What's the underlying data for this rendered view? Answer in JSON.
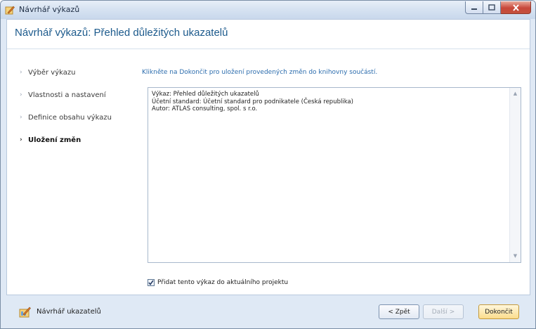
{
  "window": {
    "title": "Návrhář výkazů",
    "controls": {
      "minimize": "minimize",
      "maximize": "maximize",
      "close": "close"
    }
  },
  "header": {
    "title": "Návrhář výkazů: Přehled důležitých ukazatelů"
  },
  "nav": {
    "items": [
      {
        "label": "Výběr výkazu",
        "active": false
      },
      {
        "label": "Vlastnosti a nastavení",
        "active": false
      },
      {
        "label": "Definice obsahu výkazu",
        "active": false
      },
      {
        "label": "Uložení změn",
        "active": true
      }
    ]
  },
  "main": {
    "instruction": "Klikněte na Dokončit pro uložení provedených změn do knihovny součástí.",
    "summary_lines": [
      "Výkaz: Přehled důležitých ukazatelů",
      "Účetní standard: Účetní standard pro podnikatele (Česká republika)",
      "Autor: ATLAS consulting, spol. s r.o."
    ],
    "add_to_project": {
      "label": "Přidat tento výkaz do aktuálního projektu",
      "checked": true
    }
  },
  "footer": {
    "label": "Návrhář ukazatelů",
    "back_label": "< Zpět",
    "next_label": "Další >",
    "finish_label": "Dokončit"
  },
  "colors": {
    "accent": "#1c5a8c",
    "link": "#2b6cad",
    "chrome": "#dfe9f5",
    "finish_button": "#fbdc8c"
  },
  "icons": {
    "app": "wizard-pencil-icon",
    "footer": "designer-icon",
    "scroll_up": "chevron-up-icon",
    "scroll_down": "chevron-down-icon",
    "nav_bullet": "chevron-right-icon"
  }
}
